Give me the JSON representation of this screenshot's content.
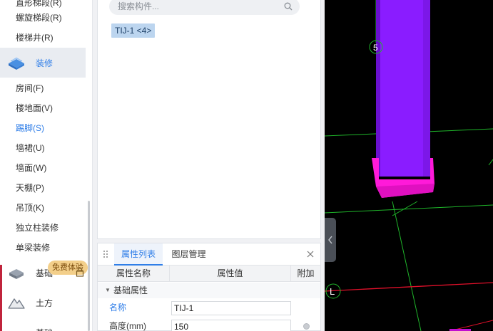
{
  "left_panel": {
    "items_top": [
      {
        "label": "直形梯段(R)"
      },
      {
        "label": "螺旋梯段(R)"
      },
      {
        "label": "楼梯井(R)"
      }
    ],
    "category_decoration": {
      "label": "装修"
    },
    "items_decoration": [
      {
        "label": "房间(F)"
      },
      {
        "label": "楼地面(V)"
      },
      {
        "label": "踢脚(S)"
      },
      {
        "label": "墙裙(U)"
      },
      {
        "label": "墙面(W)"
      },
      {
        "label": "天棚(P)"
      },
      {
        "label": "吊顶(K)"
      },
      {
        "label": "独立柱装修"
      },
      {
        "label": "单梁装修"
      }
    ],
    "category_foundation": {
      "label": "基础"
    },
    "trial_badge": "免费体验",
    "category_earthwork": {
      "label": "土方"
    },
    "category_other": {
      "label": "基础"
    },
    "accent_color": "#2f7ee8",
    "marker_color": "#c0243c"
  },
  "component_list": {
    "search_placeholder": "搜索构件...",
    "items": [
      {
        "label": "TIJ-1 <4>",
        "selected": true
      }
    ]
  },
  "properties": {
    "tabs": [
      {
        "label": "属性列表",
        "active": true
      },
      {
        "label": "图层管理",
        "active": false
      }
    ],
    "columns": [
      "属性名称",
      "属性值",
      "附加"
    ],
    "group": "基础属性",
    "rows": [
      {
        "name": "名称",
        "value": "TIJ-1"
      },
      {
        "name": "高度(mm)",
        "value": "150"
      }
    ]
  },
  "viewport": {
    "axis_labels": [
      "5",
      "L"
    ],
    "colors": {
      "column": "#8a1cff",
      "base": "#ff1ad9",
      "grid_green": "#1fb52a",
      "grid_red": "#e0102a",
      "background": "#000000"
    }
  }
}
